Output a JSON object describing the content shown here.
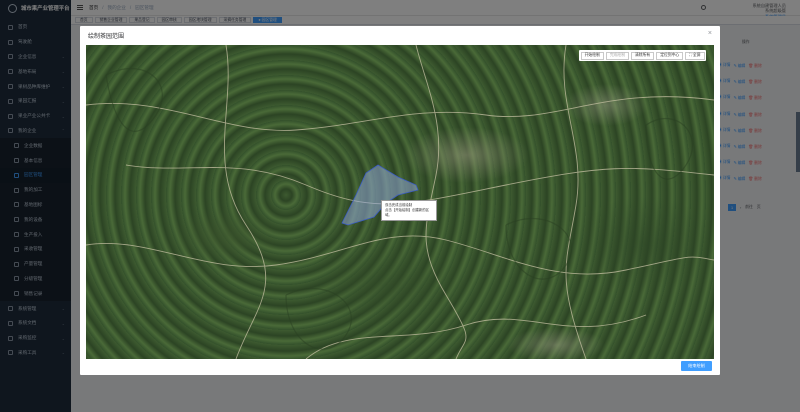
{
  "app": {
    "title": "城市果产业管理平台"
  },
  "sidebar": {
    "items": [
      {
        "label": "首页",
        "icon": "home-icon"
      },
      {
        "label": "驾驶舱",
        "icon": "dashboard-icon"
      },
      {
        "label": "企业信息",
        "icon": "building-icon",
        "arrow": "⌄"
      },
      {
        "label": "基地布局",
        "icon": "map-icon",
        "arrow": "⌄"
      },
      {
        "label": "果树品种库维护",
        "icon": "tree-icon",
        "arrow": "⌄"
      },
      {
        "label": "果园汇报",
        "icon": "report-icon",
        "arrow": "⌄"
      },
      {
        "label": "果业产业公共卡",
        "icon": "card-icon",
        "arrow": "⌄"
      },
      {
        "label": "我的企业",
        "icon": "company-icon",
        "arrow": "⌃"
      },
      {
        "label": "企业数据",
        "icon": "data-icon",
        "sub": true
      },
      {
        "label": "基本信息",
        "icon": "info-icon",
        "sub": true
      },
      {
        "label": "园区管理",
        "icon": "garden-icon",
        "sub": true,
        "active": true
      },
      {
        "label": "我的加工",
        "icon": "factory-icon",
        "sub": true
      },
      {
        "label": "基地图标",
        "icon": "flag-icon",
        "sub": true
      },
      {
        "label": "我的设备",
        "icon": "device-icon",
        "sub": true
      },
      {
        "label": "生产投入",
        "icon": "input-icon",
        "sub": true
      },
      {
        "label": "采收管理",
        "icon": "harvest-icon",
        "sub": true
      },
      {
        "label": "产量管理",
        "icon": "chart-icon",
        "sub": true
      },
      {
        "label": "分级管理",
        "icon": "grade-icon",
        "sub": true
      },
      {
        "label": "销售记录",
        "icon": "sales-icon",
        "sub": true
      },
      {
        "label": "系统管理",
        "icon": "settings-icon",
        "arrow": "⌄"
      },
      {
        "label": "系统文档",
        "icon": "doc-icon",
        "arrow": "⌄"
      },
      {
        "label": "采购监控",
        "icon": "monitor-icon",
        "arrow": "⌄"
      },
      {
        "label": "采购工具",
        "icon": "tool-icon",
        "arrow": "⌄"
      }
    ]
  },
  "header": {
    "breadcrumb": [
      "首页",
      "我的企业",
      "园区管理"
    ],
    "separator": "/",
    "user_name": "系统自建管理人员",
    "user_role": "系统超级管",
    "role_label": "系统管理员"
  },
  "tags": [
    {
      "label": "首页"
    },
    {
      "label": "销售企业管理"
    },
    {
      "label": "果品登记"
    },
    {
      "label": "园区审核"
    },
    {
      "label": "园区地块管理"
    },
    {
      "label": "采摘任务管理"
    },
    {
      "label": "● 园区管理",
      "active": true
    }
  ],
  "background_table": {
    "column_header": "操作",
    "rows": [
      {
        "view": "◉ 详情",
        "edit": "✎ 编辑",
        "del": "🗑 删除"
      },
      {
        "view": "◉ 详情",
        "edit": "✎ 编辑",
        "del": "🗑 删除"
      },
      {
        "view": "◉ 详情",
        "edit": "✎ 编辑",
        "del": "🗑 删除"
      },
      {
        "view": "◉ 详情",
        "edit": "✎ 编辑",
        "del": "🗑 删除"
      },
      {
        "view": "◉ 详情",
        "edit": "✎ 编辑",
        "del": "🗑 删除"
      },
      {
        "view": "◉ 详情",
        "edit": "✎ 编辑",
        "del": "🗑 删除"
      },
      {
        "view": "◉ 详情",
        "edit": "✎ 编辑",
        "del": "🗑 删除"
      },
      {
        "view": "◉ 详情",
        "edit": "✎ 编辑",
        "del": "🗑 删除"
      }
    ],
    "pager": {
      "current": "1",
      "goto_label": "前往",
      "page_unit": "页",
      "next": "›"
    }
  },
  "dialog": {
    "title": "绘制茶园范围",
    "close": "×",
    "toolbar": {
      "start": "开始绘制",
      "finish": "完成绘制",
      "clear": "清除所有",
      "locate": "定位到中心",
      "fullscreen": "⛶ 全屏"
    },
    "tooltip": {
      "line1": "双击完成当前绘制",
      "line2": "点击【开始绘制】创建新的区域。"
    },
    "finish_button": "结束绘制"
  },
  "colors": {
    "primary": "#409eff",
    "sidebar_bg": "#1f2d3d",
    "polygon_fill": "#8fa6d6"
  }
}
